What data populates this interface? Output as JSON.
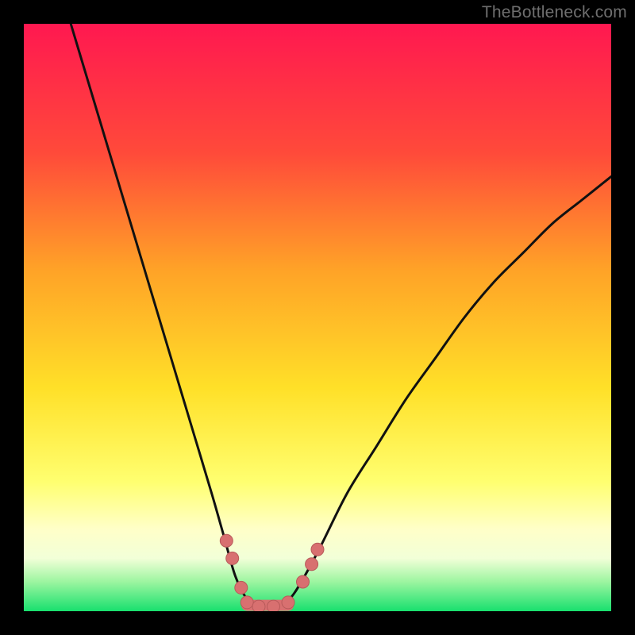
{
  "watermark": "TheBottleneck.com",
  "colors": {
    "frame": "#000000",
    "gradient_top": "#ff1850",
    "gradient_mid_upper": "#ff7a2a",
    "gradient_mid": "#ffd21e",
    "gradient_pale": "#ffffb0",
    "gradient_bottom": "#18e06e",
    "curve_stroke": "#111111",
    "marker_fill": "#d87070",
    "marker_stroke": "#b85a5a"
  },
  "chart_data": {
    "type": "line",
    "title": "",
    "xlabel": "",
    "ylabel": "",
    "xlim": [
      0,
      100
    ],
    "ylim": [
      0,
      100
    ],
    "left_curve": {
      "name": "left-branch",
      "points": [
        {
          "x": 8,
          "y": 100
        },
        {
          "x": 11,
          "y": 90
        },
        {
          "x": 14,
          "y": 80
        },
        {
          "x": 17,
          "y": 70
        },
        {
          "x": 20,
          "y": 60
        },
        {
          "x": 23,
          "y": 50
        },
        {
          "x": 26,
          "y": 40
        },
        {
          "x": 29,
          "y": 30
        },
        {
          "x": 32,
          "y": 20
        },
        {
          "x": 34,
          "y": 13
        },
        {
          "x": 36,
          "y": 6
        },
        {
          "x": 38,
          "y": 2
        },
        {
          "x": 40,
          "y": 0
        }
      ]
    },
    "right_curve": {
      "name": "right-branch",
      "points": [
        {
          "x": 43,
          "y": 0
        },
        {
          "x": 46,
          "y": 3
        },
        {
          "x": 50,
          "y": 10
        },
        {
          "x": 55,
          "y": 20
        },
        {
          "x": 60,
          "y": 28
        },
        {
          "x": 65,
          "y": 36
        },
        {
          "x": 70,
          "y": 43
        },
        {
          "x": 75,
          "y": 50
        },
        {
          "x": 80,
          "y": 56
        },
        {
          "x": 85,
          "y": 61
        },
        {
          "x": 90,
          "y": 66
        },
        {
          "x": 95,
          "y": 70
        },
        {
          "x": 100,
          "y": 74
        }
      ]
    },
    "bottom_segment": {
      "name": "optimal-zone",
      "points": [
        {
          "x": 38,
          "y": 1
        },
        {
          "x": 45,
          "y": 1
        }
      ]
    },
    "markers": [
      {
        "x": 34.5,
        "y": 12
      },
      {
        "x": 35.5,
        "y": 9
      },
      {
        "x": 37.0,
        "y": 4
      },
      {
        "x": 38.0,
        "y": 1.5
      },
      {
        "x": 40.0,
        "y": 0.8
      },
      {
        "x": 42.5,
        "y": 0.8
      },
      {
        "x": 45.0,
        "y": 1.5
      },
      {
        "x": 47.5,
        "y": 5
      },
      {
        "x": 49.0,
        "y": 8
      },
      {
        "x": 50.0,
        "y": 10.5
      }
    ]
  }
}
